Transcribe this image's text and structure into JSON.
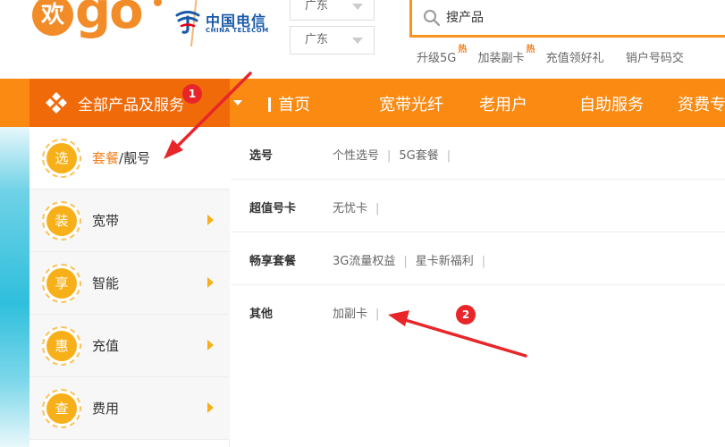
{
  "header": {
    "logo_char": "欢",
    "logo_text": "go",
    "telecom_cn": "中国电信",
    "telecom_en": "CHINA TELECOM",
    "region_1": "广东",
    "region_2": "广东",
    "search_placeholder": "搜产品",
    "hot_links": [
      {
        "label": "升级5G",
        "badge": "热"
      },
      {
        "label": "加装副卡",
        "badge": "热"
      },
      {
        "label": "充值领好礼",
        "badge": ""
      },
      {
        "label": "销户号码交",
        "badge": ""
      }
    ]
  },
  "nav": {
    "all_label": "全部产品及服务",
    "items": [
      "首页",
      "宽带光纤",
      "老用户",
      "自助服务",
      "资费专"
    ]
  },
  "categories": [
    {
      "icon_char": "选",
      "label_highlight": "套餐",
      "label_rest": "/靓号"
    },
    {
      "icon_char": "装",
      "label": "宽带"
    },
    {
      "icon_char": "享",
      "label": "智能"
    },
    {
      "icon_char": "惠",
      "label": "充值"
    },
    {
      "icon_char": "查",
      "label": "费用"
    }
  ],
  "panel": {
    "rows": [
      {
        "title": "选号",
        "links": [
          "个性选号",
          "5G套餐"
        ]
      },
      {
        "title": "超值号卡",
        "links": [
          "无忧卡"
        ]
      },
      {
        "title": "畅享套餐",
        "links": [
          "3G流量权益",
          "星卡新福利"
        ]
      },
      {
        "title": "其他",
        "links": [
          "加副卡"
        ]
      }
    ]
  },
  "annotations": {
    "step1": "1",
    "step2": "2"
  },
  "colors": {
    "brand_orange": "#fb8a13",
    "dark_orange": "#f06a0a",
    "telecom_blue": "#1a5aa8",
    "badge_yellow": "#f8b01a",
    "annotation_red": "#e8262a"
  }
}
